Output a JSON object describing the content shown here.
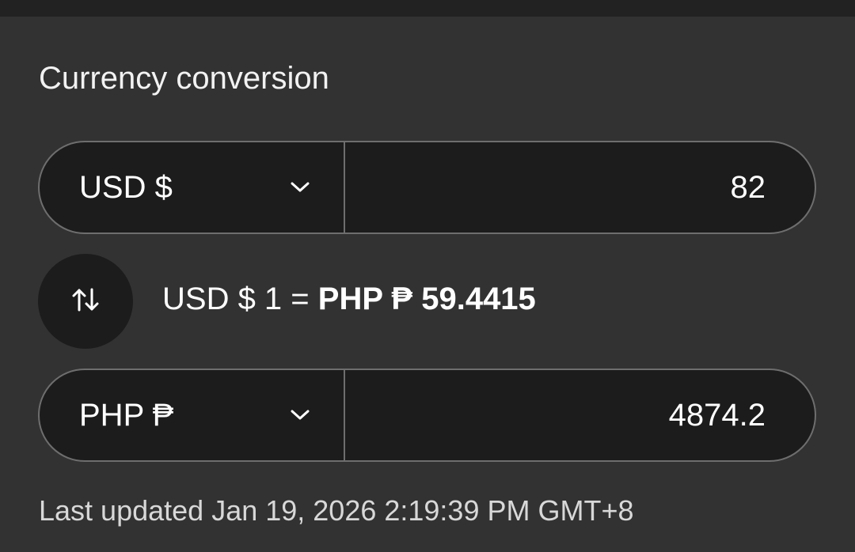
{
  "title": "Currency conversion",
  "colors": {
    "background": "#323232",
    "top_strip": "#222222",
    "field_background": "#1c1c1c",
    "border": "#6e6e6e",
    "text": "#ffffff",
    "muted_text": "#d8d8d8"
  },
  "from": {
    "currency_label": "USD $",
    "dropdown_icon": "chevron-down-icon",
    "amount": "82"
  },
  "swap": {
    "icon": "swap-vertical-arrows-icon"
  },
  "rate": {
    "from_text": "USD $ 1 =",
    "to_text": "PHP ₱ 59.4415"
  },
  "to": {
    "currency_label": "PHP ₱",
    "dropdown_icon": "chevron-down-icon",
    "amount": "4874.2"
  },
  "last_updated": {
    "label": "Last updated",
    "timestamp": "Jan 19, 2026 2:19:39 PM GMT+8"
  }
}
